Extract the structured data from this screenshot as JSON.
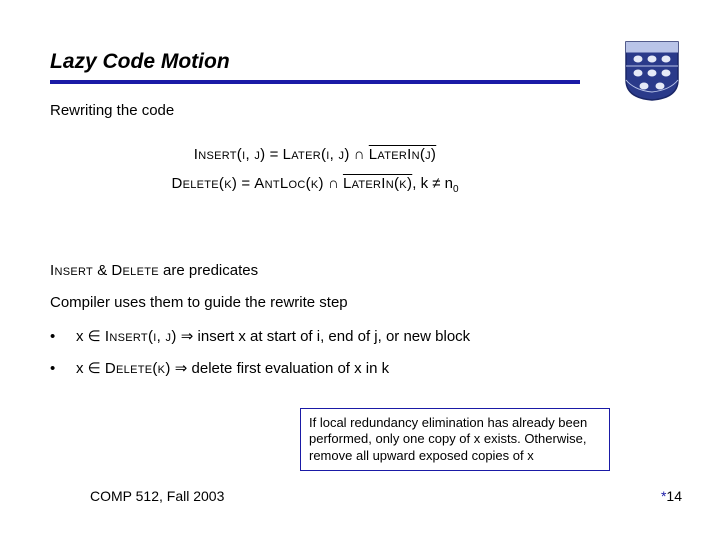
{
  "title": "Lazy Code Motion",
  "subtitle": "Rewriting the code",
  "equations": {
    "line1": {
      "lhs": "Insert(i, j)",
      "eq": " = ",
      "rhs1": "Later(i, j)",
      "op": " ∩ ",
      "rhs2_over": "LaterIn(j)"
    },
    "line2": {
      "lhs": "Delete(k)",
      "eq": " = ",
      "rhs1": "AntLoc(k)",
      "op": " ∩ ",
      "rhs2_over": "LaterIn(k)",
      "tail": ", k ≠ n",
      "tail_sub": "0"
    }
  },
  "body": {
    "p1_a": "Insert",
    "p1_b": " & ",
    "p1_c": "Delete",
    "p1_d": " are predicates",
    "p2": "Compiler uses them to guide the rewrite step"
  },
  "bullets": [
    {
      "pre": "x ∈ ",
      "pred": "Insert(i, j)",
      "arrow": " ⇒ ",
      "post": "insert x at start of i, end of j, or new block"
    },
    {
      "pre": "x ∈ ",
      "pred": "Delete(k)",
      "arrow": " ⇒ ",
      "post": "delete first evaluation of x in k"
    }
  ],
  "note": "If local redundancy elimination has already been performed, only one copy of x exists.  Otherwise, remove all upward exposed copies of x",
  "footer": {
    "left": "COMP 512, Fall 2003",
    "right_num": "14",
    "star": "*"
  },
  "logo": {
    "name": "rice-owl-shield"
  }
}
